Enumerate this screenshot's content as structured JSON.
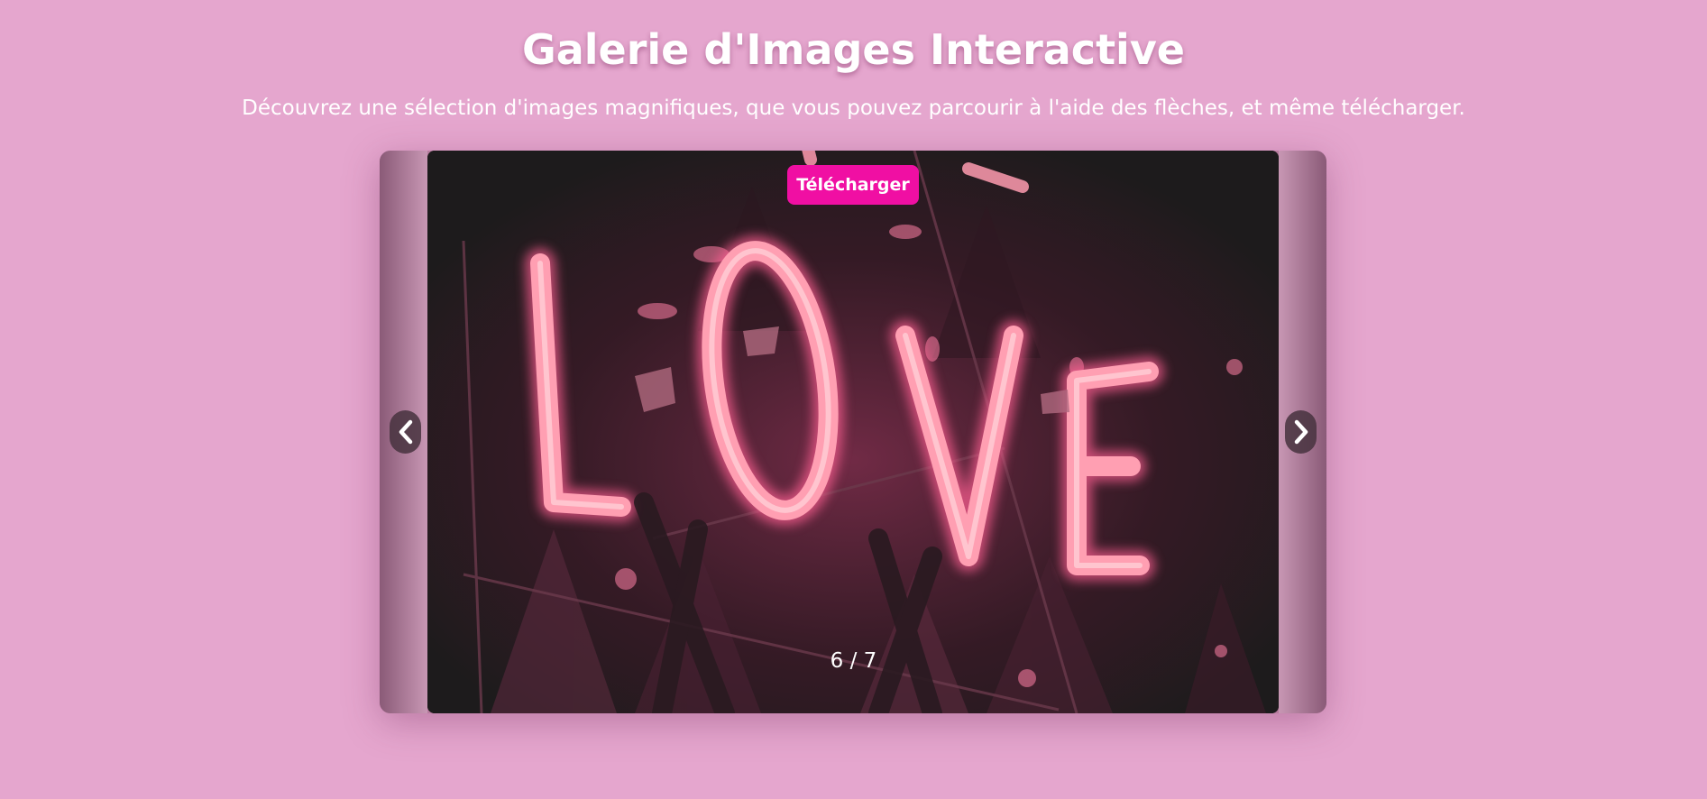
{
  "header": {
    "title": "Galerie d'Images Interactive",
    "subtitle": "Découvrez une sélection d'images magnifiques, que vous pouvez parcourir à l'aide des flèches, et même télécharger."
  },
  "gallery": {
    "download_label": "Télécharger",
    "counter": "6 / 7",
    "current_index": 6,
    "total": 7,
    "prev_icon": "chevron-left-icon",
    "next_icon": "chevron-right-icon",
    "image_text": "LOVE"
  },
  "colors": {
    "background": "#e5a6ce",
    "accent": "#f00fa3",
    "neon": "#ff9bb0"
  }
}
